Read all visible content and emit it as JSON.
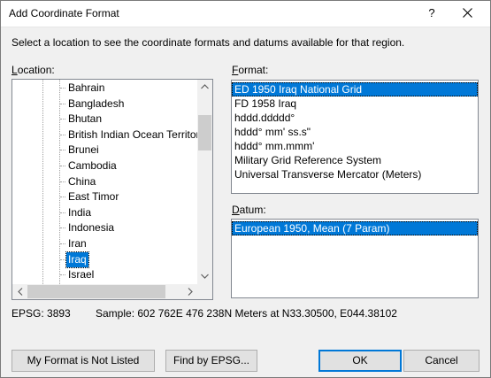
{
  "window": {
    "title": "Add Coordinate Format",
    "help_glyph": "?"
  },
  "intro_text": "Select a location to see the coordinate formats and datums available for that region.",
  "location": {
    "label_key": "L",
    "label_rest": "ocation:",
    "items": [
      {
        "label": "Bahrain",
        "selected": false
      },
      {
        "label": "Bangladesh",
        "selected": false
      },
      {
        "label": "Bhutan",
        "selected": false
      },
      {
        "label": "British Indian Ocean Territory",
        "selected": false
      },
      {
        "label": "Brunei",
        "selected": false
      },
      {
        "label": "Cambodia",
        "selected": false
      },
      {
        "label": "China",
        "selected": false
      },
      {
        "label": "East Timor",
        "selected": false
      },
      {
        "label": "India",
        "selected": false
      },
      {
        "label": "Indonesia",
        "selected": false
      },
      {
        "label": "Iran",
        "selected": false
      },
      {
        "label": "Iraq",
        "selected": true
      },
      {
        "label": "Israel",
        "selected": false
      }
    ]
  },
  "format": {
    "label_key": "F",
    "label_rest": "ormat:",
    "items": [
      {
        "label": "ED 1950 Iraq National Grid",
        "selected": true
      },
      {
        "label": "FD 1958 Iraq",
        "selected": false
      },
      {
        "label": "hddd.ddddd°",
        "selected": false
      },
      {
        "label": "hddd° mm' ss.s\"",
        "selected": false
      },
      {
        "label": "hddd° mm.mmm'",
        "selected": false
      },
      {
        "label": "Military Grid Reference System",
        "selected": false
      },
      {
        "label": "Universal Transverse Mercator (Meters)",
        "selected": false
      }
    ]
  },
  "datum": {
    "label_key": "D",
    "label_rest": "atum:",
    "items": [
      {
        "label": "European 1950, Mean (7 Param)",
        "selected": true
      }
    ]
  },
  "status": {
    "epsg": "EPSG: 3893",
    "sample": "Sample: 602 762E  476 238N Meters at N33.30500, E044.38102"
  },
  "buttons": {
    "not_listed": "My Format is Not Listed",
    "find_epsg": "Find by EPSG...",
    "ok": "OK",
    "cancel": "Cancel"
  },
  "colors": {
    "selection": "#0078d7",
    "dialog_bg": "#f0f0f0"
  }
}
